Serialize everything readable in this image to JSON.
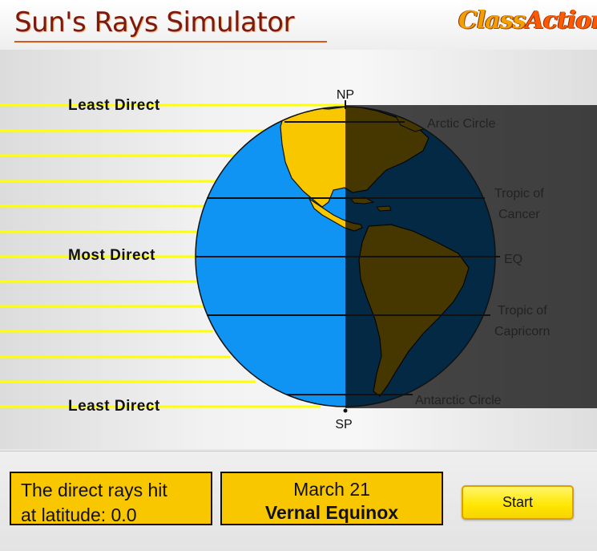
{
  "header": {
    "title": "Sun's Rays Simulator",
    "logo_part1": "Class",
    "logo_part2": "Action"
  },
  "simulation": {
    "ray_labels": {
      "top": "Least Direct",
      "middle": "Most Direct",
      "bottom": "Least Direct"
    },
    "pole_labels": {
      "north": "NP",
      "south": "SP"
    },
    "latitude_labels": {
      "arctic": "Arctic Circle",
      "cancer_line1": "Tropic of",
      "cancer_line2": "Cancer",
      "equator": "EQ",
      "capricorn_line1": "Tropic of",
      "capricorn_line2": "Capricorn",
      "antarctic": "Antarctic Circle"
    },
    "colors": {
      "ocean": "#0f94f4",
      "land": "#f9c700",
      "ray": "#ffff00",
      "night_shade": "#000000"
    }
  },
  "panel": {
    "latitude_line1": "The direct rays hit",
    "latitude_line2": "at latitude: 0.0",
    "date": "March 21",
    "event": "Vernal Equinox",
    "start_label": "Start"
  }
}
